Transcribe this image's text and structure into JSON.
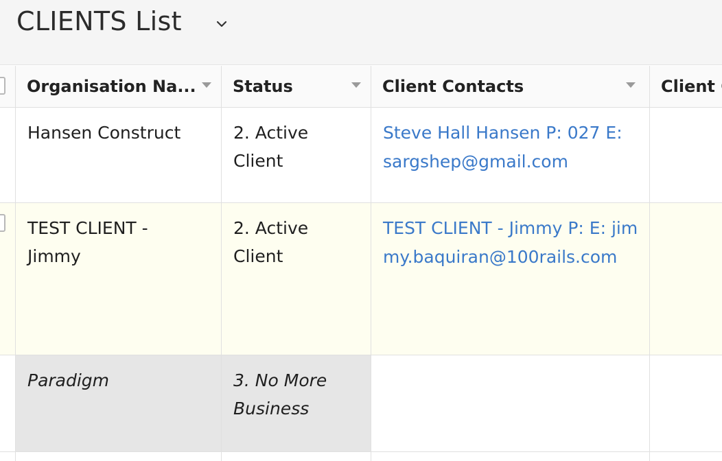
{
  "view": {
    "title": "CLIENTS List",
    "dropdown_icon": "chevron-down-icon"
  },
  "columns": [
    {
      "label": "Organisation Na...",
      "sort_icon": "caret-down-icon"
    },
    {
      "label": "Status",
      "sort_icon": "caret-down-icon"
    },
    {
      "label": "Client Contacts",
      "sort_icon": "caret-down-icon"
    },
    {
      "label": "Client C"
    }
  ],
  "rows": [
    {
      "organisation": "Hansen Construct",
      "status": "2. Active Client",
      "contacts": "Steve Hall Hansen P: 027 E: sargshep@gmail.com",
      "highlight": false
    },
    {
      "organisation": "TEST CLIENT - Jimmy",
      "status": "2. Active Client",
      "contacts": "TEST CLIENT - Jimmy P: E: jimmy.baquiran@100rails.com",
      "highlight": true
    },
    {
      "organisation": "Paradigm",
      "status": "3. No More Business",
      "contacts": "",
      "inactive": true
    }
  ],
  "colors": {
    "link": "#3a79c9",
    "highlight_row": "#fefef0",
    "inactive_cell": "#e6e6e6",
    "header_bg": "#f5f5f5"
  }
}
